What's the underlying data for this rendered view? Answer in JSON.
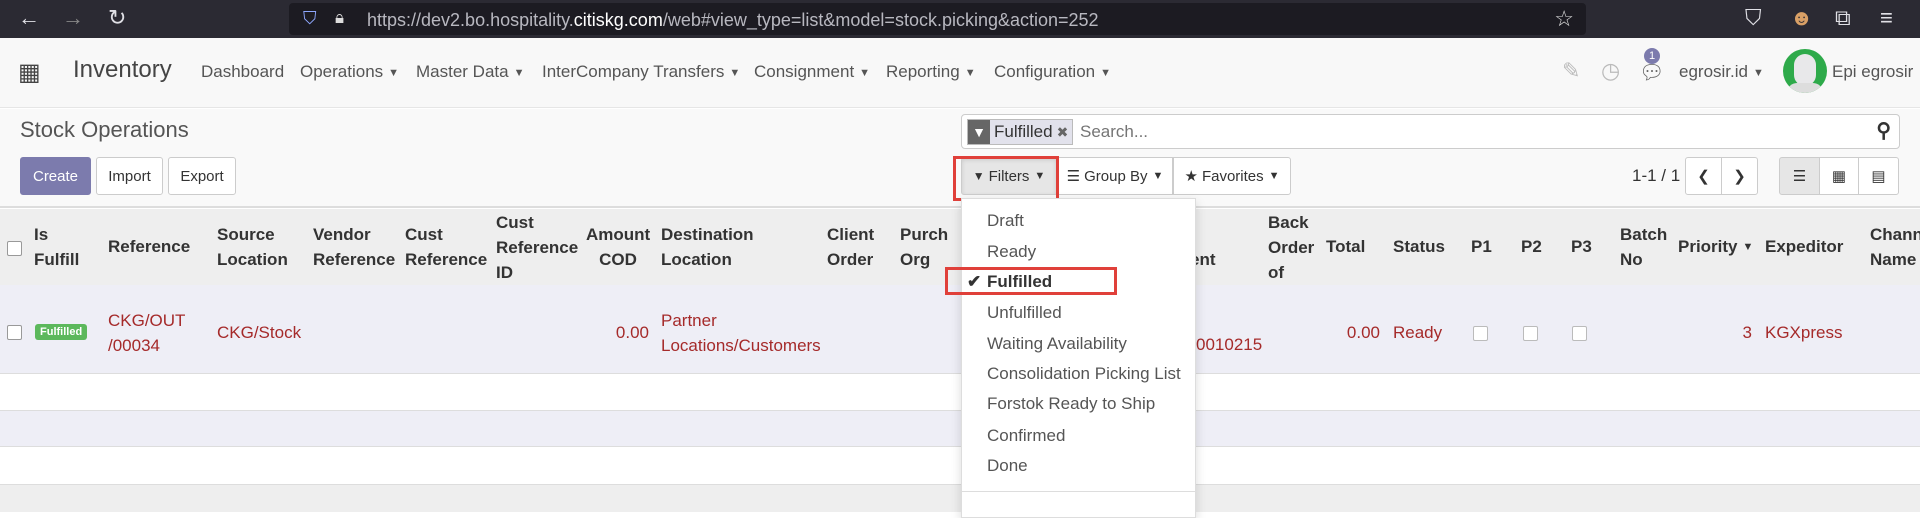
{
  "browser": {
    "url_prefix": "https://dev2.bo.hospitality.",
    "url_domain": "citiskg.com",
    "url_suffix": "/web#view_type=list&model=stock.picking&action=252"
  },
  "navbar": {
    "app_name": "Inventory",
    "menu": [
      "Dashboard",
      "Operations",
      "Master Data",
      "InterCompany Transfers",
      "Consignment",
      "Reporting",
      "Configuration"
    ],
    "menu_has_caret": [
      false,
      true,
      true,
      true,
      true,
      true,
      true
    ],
    "chat_badge": "1",
    "company": "egrosir.id",
    "user": "Epi egrosir"
  },
  "page": {
    "title": "Stock Operations",
    "create": "Create",
    "import": "Import",
    "export": "Export"
  },
  "search": {
    "facet": "Fulfilled",
    "placeholder": "Search...",
    "filters": "Filters",
    "group_by": "Group By",
    "favorites": "Favorites",
    "pager": "1-1 / 1"
  },
  "filters_menu": {
    "items": [
      "Draft",
      "Ready",
      "Fulfilled",
      "Unfulfilled",
      "Waiting Availability",
      "Consolidation Picking List",
      "Forstok Ready to Ship",
      "Confirmed",
      "Done"
    ],
    "checked": "Fulfilled"
  },
  "table": {
    "headers": {
      "is_fulfill": "Is Fulfill",
      "reference": "Reference",
      "source": "Source Location",
      "vendor_ref": "Vendor Reference",
      "cust_ref": "Cust Reference",
      "cust_ref_id": "Cust Reference ID",
      "amount_cod": "Amount COD",
      "destination": "Destination Location",
      "client_order": "Client Order",
      "purch_org": "Purch Org",
      "hidden_partial": "ent",
      "back_order": "Back Order of",
      "total": "Total",
      "status": "Status",
      "p1": "P1",
      "p2": "P2",
      "p3": "P3",
      "batch": "Batch No",
      "priority": "Priority",
      "expeditor": "Expeditor",
      "channel": "Chann Name"
    },
    "rows": [
      {
        "is_fulfill": "Fulfilled",
        "reference": "CKG/OUT /00034",
        "source": "CKG/Stock",
        "amount_cod": "0.00",
        "destination": "Partner Locations/Customers",
        "hidden_partial": "0010215",
        "total": "0.00",
        "status": "Ready",
        "priority": "3",
        "expeditor": "KGXpress"
      }
    ]
  },
  "colors": {
    "primary": "#7c7bad",
    "link": "#a52a2a",
    "badge_success": "#5cb85c",
    "highlight": "#e74c3c"
  }
}
